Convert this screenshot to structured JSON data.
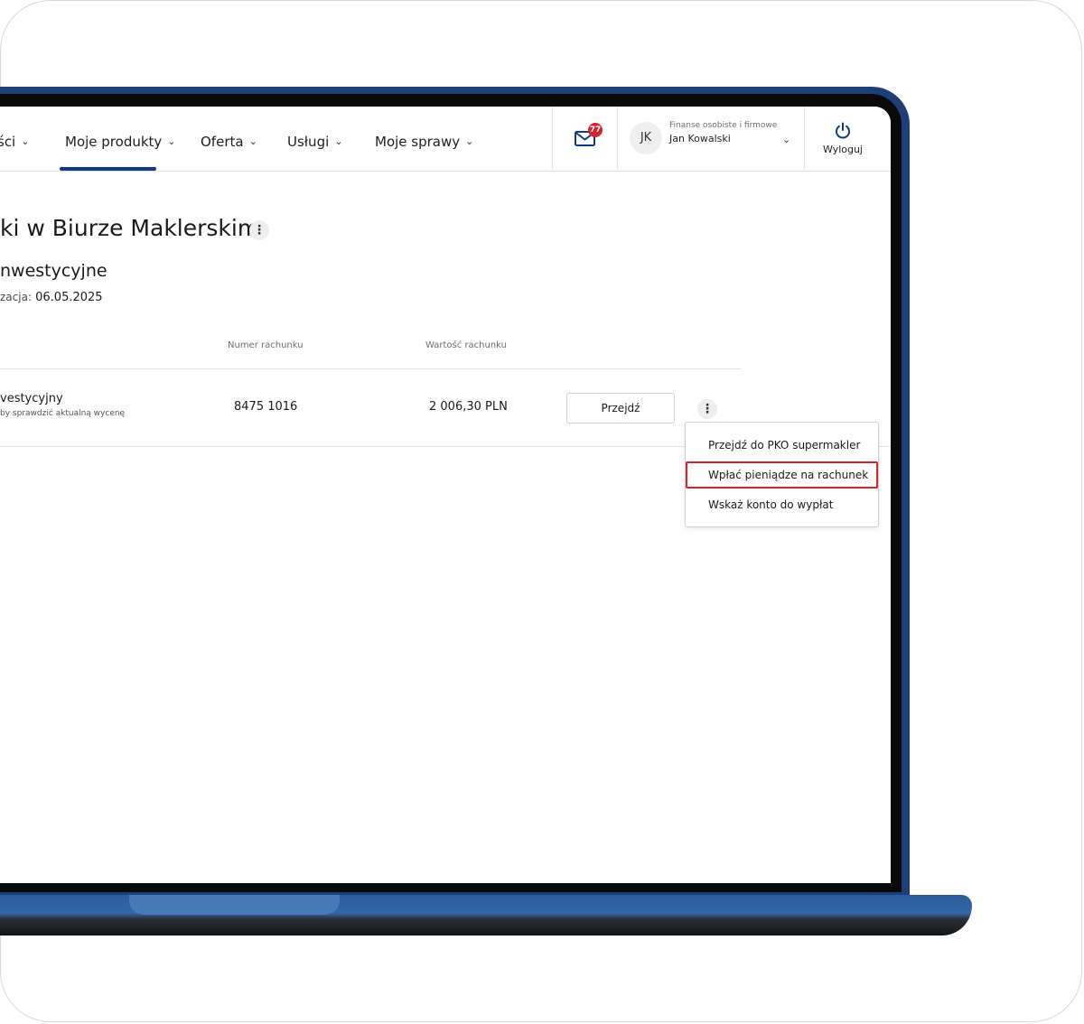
{
  "nav": {
    "items": [
      {
        "label": "ści"
      },
      {
        "label": "Moje produkty"
      },
      {
        "label": "Oferta"
      },
      {
        "label": "Usługi"
      },
      {
        "label": "Moje sprawy"
      }
    ],
    "active_item": "Moje produkty",
    "mail_badge": "77",
    "user": {
      "initials": "JK",
      "context": "Finanse osobiste i firmowe",
      "name": "Jan Kowalski"
    },
    "logout_label": "Wyloguj"
  },
  "page": {
    "title": "ki w Biurze Maklerskim",
    "section_title": "nwestycyjne",
    "update_label": "zacja:",
    "update_date": "06.05.2025"
  },
  "table": {
    "columns": [
      "Numer rachunku",
      "Wartość rachunku"
    ],
    "rows": [
      {
        "name": "vestycyjny",
        "subtext": "by sprawdzić aktualną wycenę",
        "number": "8475 1016",
        "value": "2 006,30 PLN",
        "action_label": "Przejdź"
      }
    ]
  },
  "menu": {
    "items": [
      {
        "label": "Przejdź do PKO supermakler"
      },
      {
        "label": "Wpłać pieniądze na rachunek"
      },
      {
        "label": "Wskaż konto do wypłat"
      }
    ],
    "highlighted_index": 1
  },
  "colors": {
    "brand_navy": "#0f3b82",
    "laptop_blue": "#1d3f75",
    "badge_red": "#d8232a",
    "highlight_red": "#d8232a"
  }
}
